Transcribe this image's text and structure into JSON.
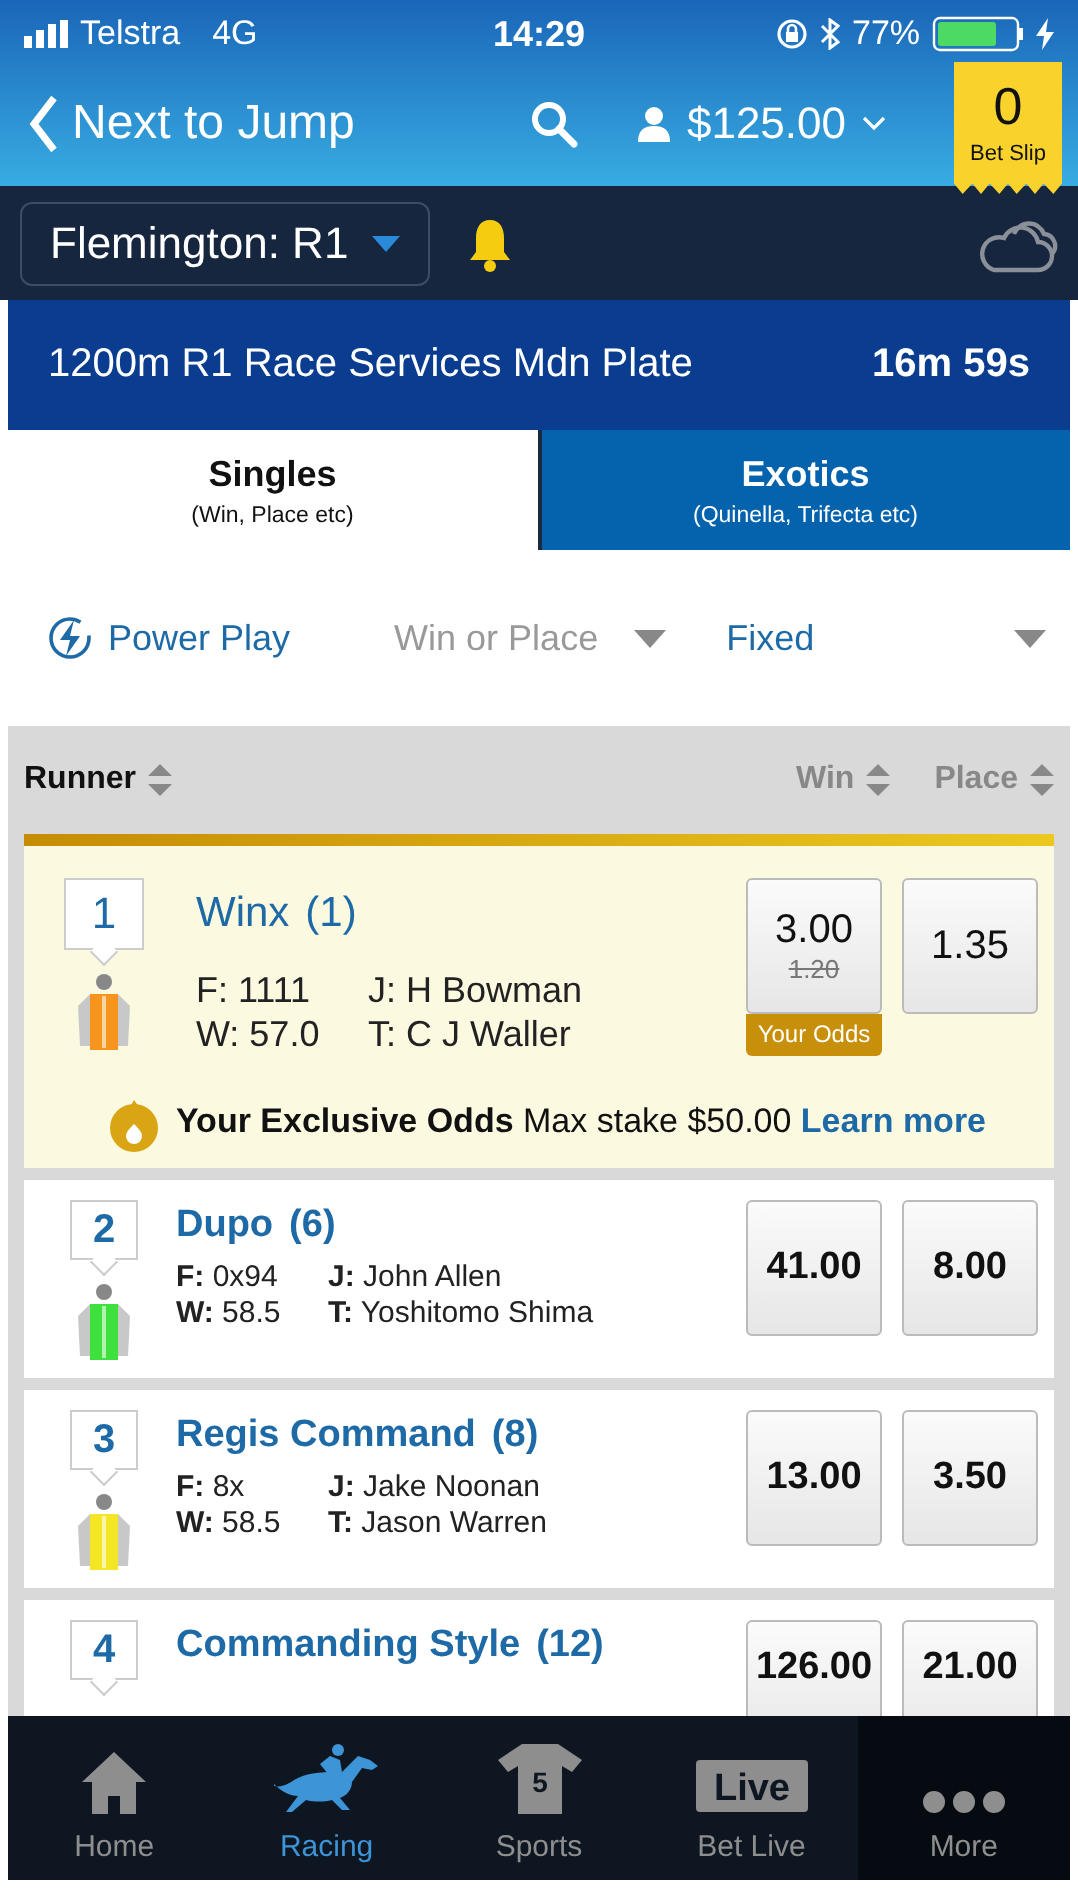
{
  "status_bar": {
    "carrier": "Telstra",
    "network": "4G",
    "time": "14:29",
    "battery": "77%"
  },
  "header": {
    "back_label": "Next to Jump",
    "balance": "$125.00",
    "bet_slip": {
      "count": "0",
      "label": "Bet Slip"
    }
  },
  "meeting": {
    "name": "Flemington: R1"
  },
  "race": {
    "title": "1200m R1 Race Services Mdn Plate",
    "countdown": "16m 59s"
  },
  "tabs": [
    {
      "title": "Singles",
      "subtitle": "(Win, Place etc)",
      "selected": true
    },
    {
      "title": "Exotics",
      "subtitle": "(Quinella, Trifecta etc)",
      "selected": false
    }
  ],
  "filters": {
    "power_play": "Power Play",
    "bet_type": "Win or Place",
    "odds_type": "Fixed"
  },
  "table": {
    "columns": [
      "Runner",
      "Win",
      "Place"
    ]
  },
  "runners": [
    {
      "kind": "featured",
      "number": "1",
      "name": "Winx",
      "barrier": "(1)",
      "color": "#f7941d",
      "details": [
        {
          "label": "F:",
          "value": "1111"
        },
        {
          "label": "J:",
          "value": "H Bowman"
        },
        {
          "label": "W:",
          "value": "57.0"
        },
        {
          "label": "T:",
          "value": "C J Waller"
        }
      ],
      "win": "3.00",
      "old_win": "1.20",
      "odds_tag": "Your Odds",
      "place": "1.35",
      "promo": {
        "text": "**Your Exclusive Odds** Max stake $50.00",
        "link": "Learn more"
      }
    },
    {
      "kind": "normal",
      "number": "2",
      "name": "Dupo",
      "barrier": "(6)",
      "color": "#3ee03e",
      "details": [
        {
          "label": "F:",
          "value": "0x94"
        },
        {
          "label": "J:",
          "value": "John Allen"
        },
        {
          "label": "W:",
          "value": "58.5"
        },
        {
          "label": "T:",
          "value": "Yoshitomo Shima"
        }
      ],
      "win": "41.00",
      "place": "8.00"
    },
    {
      "kind": "normal",
      "number": "3",
      "name": "Regis Command",
      "barrier": "(8)",
      "color": "#f5e625",
      "details": [
        {
          "label": "F:",
          "value": "8x"
        },
        {
          "label": "J:",
          "value": "Jake Noonan"
        },
        {
          "label": "W:",
          "value": "58.5"
        },
        {
          "label": "T:",
          "value": "Jason Warren"
        }
      ],
      "win": "13.00",
      "place": "3.50"
    },
    {
      "kind": "cut",
      "number": "4",
      "name": "Commanding Style",
      "barrier": "(12)",
      "win": "126.00",
      "place": "21.00"
    }
  ],
  "nav": [
    {
      "kind": "home",
      "label": "Home",
      "selected": false
    },
    {
      "kind": "racing",
      "label": "Racing",
      "selected": true
    },
    {
      "kind": "sports",
      "label": "Sports",
      "shirt_number": "5",
      "selected": false
    },
    {
      "kind": "live",
      "label": "Bet Live",
      "badge": "Live",
      "selected": false
    },
    {
      "kind": "more",
      "label": "More",
      "selected": false
    }
  ]
}
